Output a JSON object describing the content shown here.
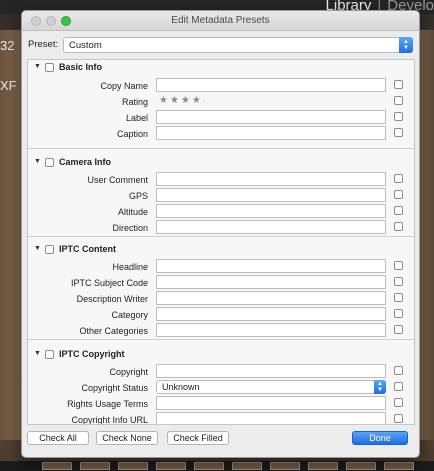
{
  "background": {
    "module_active": "Library",
    "module_next": "Develo",
    "edge_text": [
      "32",
      "XF"
    ]
  },
  "dialog": {
    "title": "Edit Metadata Presets",
    "preset": {
      "label": "Preset:",
      "value": "Custom"
    },
    "sections": [
      {
        "title": "Basic Info",
        "fields": [
          {
            "label": "Copy Name",
            "type": "text",
            "value": ""
          },
          {
            "label": "Rating",
            "type": "rating",
            "value": 0,
            "max": 5
          },
          {
            "label": "Label",
            "type": "text",
            "value": ""
          },
          {
            "label": "Caption",
            "type": "text",
            "value": ""
          }
        ]
      },
      {
        "title": "Camera Info",
        "fields": [
          {
            "label": "User Comment",
            "type": "text",
            "value": ""
          },
          {
            "label": "GPS",
            "type": "text",
            "value": ""
          },
          {
            "label": "Altitude",
            "type": "text",
            "value": ""
          },
          {
            "label": "Direction",
            "type": "text",
            "value": ""
          }
        ]
      },
      {
        "title": "IPTC Content",
        "fields": [
          {
            "label": "Headline",
            "type": "text",
            "value": ""
          },
          {
            "label": "IPTC Subject Code",
            "type": "text",
            "value": ""
          },
          {
            "label": "Description Writer",
            "type": "text",
            "value": ""
          },
          {
            "label": "Category",
            "type": "text",
            "value": ""
          },
          {
            "label": "Other Categories",
            "type": "text",
            "value": ""
          }
        ]
      },
      {
        "title": "IPTC Copyright",
        "fields": [
          {
            "label": "Copyright",
            "type": "text",
            "value": ""
          },
          {
            "label": "Copyright Status",
            "type": "select",
            "value": "Unknown"
          },
          {
            "label": "Rights Usage Terms",
            "type": "text",
            "value": ""
          },
          {
            "label": "Copyright Info URL",
            "type": "text",
            "value": ""
          }
        ]
      }
    ],
    "buttons": {
      "check_all": "Check All",
      "check_none": "Check None",
      "check_filled": "Check Filled",
      "done": "Done"
    }
  },
  "colors": {
    "accent": "#1e6fe0",
    "traffic_zoom": "#3cc14a"
  }
}
